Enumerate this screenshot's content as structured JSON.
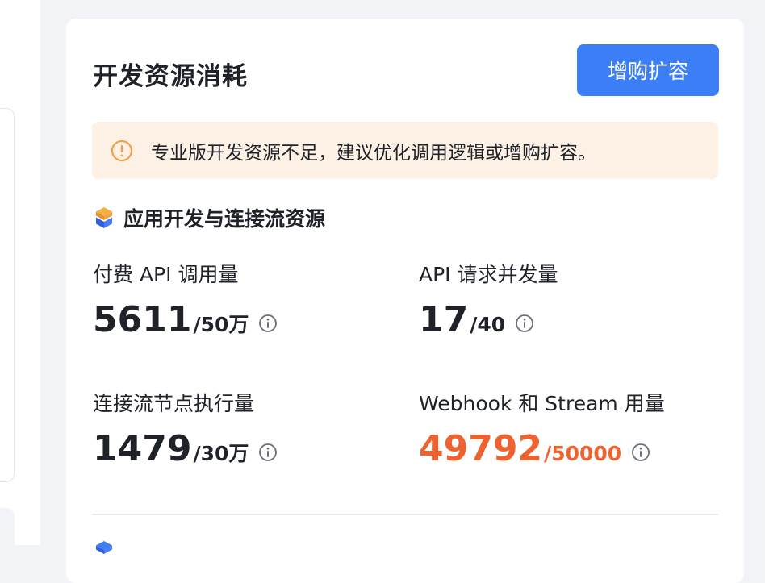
{
  "card": {
    "title": "开发资源消耗",
    "buy_button_label": "增购扩容"
  },
  "alert": {
    "icon": "warning-circle-icon",
    "text": "专业版开发资源不足，建议优化调用逻辑或增购扩容。",
    "color": "#f0a04b"
  },
  "section": {
    "icon": "cube-icon",
    "title": "应用开发与连接流资源"
  },
  "metrics": [
    {
      "label": "付费 API 调用量",
      "value": "5611",
      "limit": "/50万",
      "warn": false
    },
    {
      "label": "API 请求并发量",
      "value": "17",
      "limit": "/40",
      "warn": false
    },
    {
      "label": "连接流节点执行量",
      "value": "1479",
      "limit": "/30万",
      "warn": false
    },
    {
      "label": "Webhook 和 Stream 用量",
      "value": "49792",
      "limit": "/50000",
      "warn": true
    }
  ],
  "colors": {
    "accent": "#3b7ef6",
    "warning": "#ee6230",
    "alert_bg": "#fdf1e6"
  }
}
